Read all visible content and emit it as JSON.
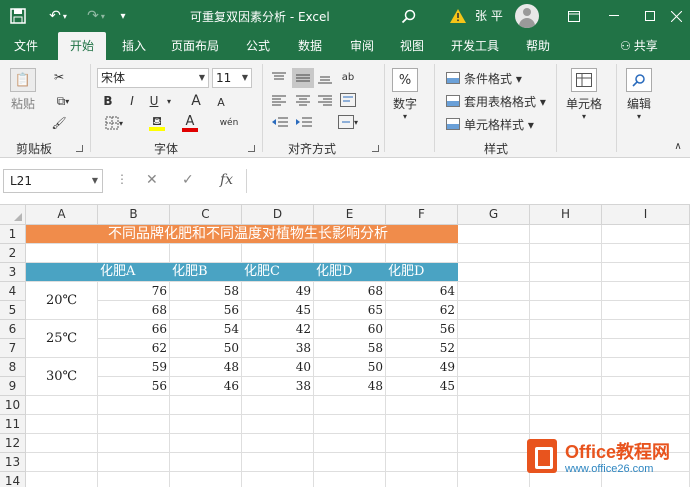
{
  "window": {
    "title": "可重复双因素分析 - Excel",
    "user": "张 平"
  },
  "tabs": [
    "文件",
    "开始",
    "插入",
    "页面布局",
    "公式",
    "数据",
    "审阅",
    "视图",
    "开发工具",
    "帮助"
  ],
  "share_label": "共享",
  "ribbon": {
    "clipboard": {
      "paste": "粘贴",
      "label": "剪贴板"
    },
    "font": {
      "name": "宋体",
      "size": "11",
      "label": "字体",
      "grow": "A",
      "shrink": "A",
      "wen": "wén",
      "bold": "B",
      "italic": "I",
      "underline": "U"
    },
    "alignment": {
      "label": "对齐方式"
    },
    "number": {
      "symbol": "%",
      "label": "数字"
    },
    "styles": {
      "conditional": "条件格式 ▾",
      "table": "套用表格格式 ▾",
      "cell": "单元格样式 ▾",
      "label": "样式"
    },
    "cells": {
      "label": "单元格"
    },
    "editing": {
      "label": "编辑"
    }
  },
  "formula_bar": {
    "name_box": "L21",
    "fx": "fx",
    "value": ""
  },
  "columns": [
    "A",
    "B",
    "C",
    "D",
    "E",
    "F",
    "G",
    "H",
    "I"
  ],
  "rows": [
    "1",
    "2",
    "3",
    "4",
    "5",
    "6",
    "7",
    "8",
    "9",
    "10",
    "11",
    "12",
    "13",
    "14"
  ],
  "sheet": {
    "title": "不同品牌化肥和不同温度对植物生长影响分析",
    "headers": [
      "化肥A",
      "化肥B",
      "化肥C",
      "化肥D",
      "化肥D"
    ],
    "temps": [
      "20℃",
      "25℃",
      "30℃"
    ],
    "data": [
      [
        "76",
        "58",
        "49",
        "68",
        "64"
      ],
      [
        "68",
        "56",
        "45",
        "65",
        "62"
      ],
      [
        "66",
        "54",
        "42",
        "60",
        "56"
      ],
      [
        "62",
        "50",
        "38",
        "58",
        "52"
      ],
      [
        "59",
        "48",
        "40",
        "50",
        "49"
      ],
      [
        "56",
        "46",
        "38",
        "48",
        "45"
      ]
    ]
  },
  "watermark": {
    "name": "Office教程网",
    "url": "www.office26.com"
  },
  "colors": {
    "excel_green": "#217346",
    "title_band": "#f08c4b",
    "header_band": "#4aa3c3",
    "watermark": "#e8541e"
  }
}
